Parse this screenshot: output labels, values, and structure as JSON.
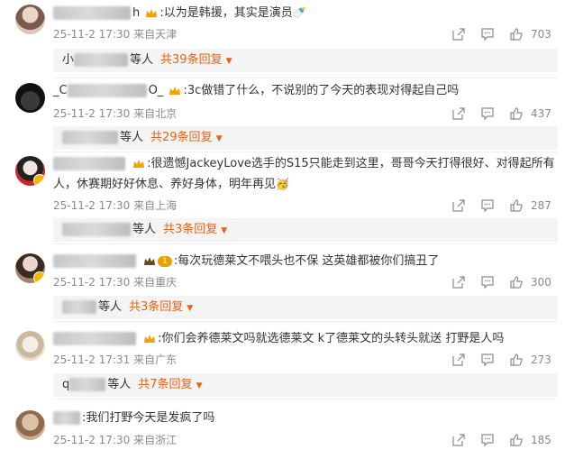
{
  "comments": [
    {
      "text": ":以为是韩援，其实是演员",
      "timestamp": "25-11-2 17:30",
      "location": "来自天津",
      "likes": "703",
      "reply_prefix": "小",
      "reply_people": "等人",
      "reply_count": "共39条回复",
      "name_fragment": "h"
    },
    {
      "text": ":3c做错了什么，不说别的了今天的表现对得起自己吗",
      "timestamp": "25-11-2 17:30",
      "location": "来自北京",
      "likes": "437",
      "reply_people": "等人",
      "reply_count": "共29条回复",
      "name_prefix": "_C",
      "name_suffix": "O_"
    },
    {
      "text": ":很遗憾JackeyLove选手的S15只能走到这里，哥哥今天打得很好、对得起所有人，休赛期好好休息、养好身体，明年再见",
      "timestamp": "25-11-2 17:30",
      "location": "来自上海",
      "likes": "287",
      "reply_people": "等人",
      "reply_count": "共3条回复"
    },
    {
      "text": ":每次玩德莱文不喂头也不保 这英雄都被你们搞丑了",
      "timestamp": "25-11-2 17:30",
      "location": "来自重庆",
      "likes": "300",
      "level_badge": "1",
      "reply_people": "等人",
      "reply_count": "共3条回复"
    },
    {
      "text": ":你们会养德莱文吗就选德莱文  k了德莱文的头转头就送 打野是人吗",
      "timestamp": "25-11-2 17:31",
      "location": "来自广东",
      "likes": "273",
      "reply_prefix": "q",
      "reply_people": "等人",
      "reply_count": "共7条回复"
    },
    {
      "text": ":我们打野今天是发疯了吗",
      "timestamp": "25-11-2 17:30",
      "location": "来自浙江",
      "likes": "185"
    }
  ],
  "icons": {
    "share": "share-icon",
    "comment": "comment-icon",
    "like": "like-icon",
    "caret": "caret-down-icon"
  },
  "colors": {
    "accent_orange": "#e3641a",
    "badge_gold": "#f6b400",
    "meta_gray": "#8a8a8a"
  }
}
